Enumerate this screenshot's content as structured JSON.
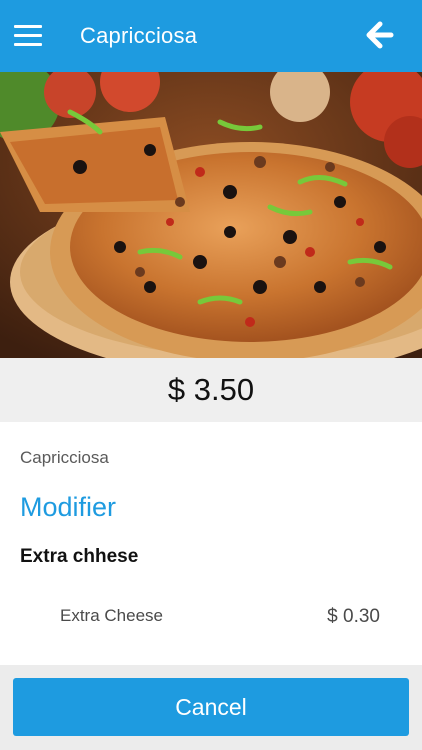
{
  "header": {
    "title": "Capricciosa",
    "menu_icon": "hamburger-menu-icon",
    "back_icon": "arrow-left-icon",
    "background_color": "#1e9be0"
  },
  "hero": {
    "image_subject": "pizza"
  },
  "price": {
    "text": "$ 3.50"
  },
  "details": {
    "item_name": "Capricciosa",
    "section_title": "Modifier",
    "group_title": "Extra chhese",
    "options": [
      {
        "label": "Extra Cheese",
        "price": "$ 0.30"
      }
    ]
  },
  "footer": {
    "cancel_label": "Cancel"
  }
}
